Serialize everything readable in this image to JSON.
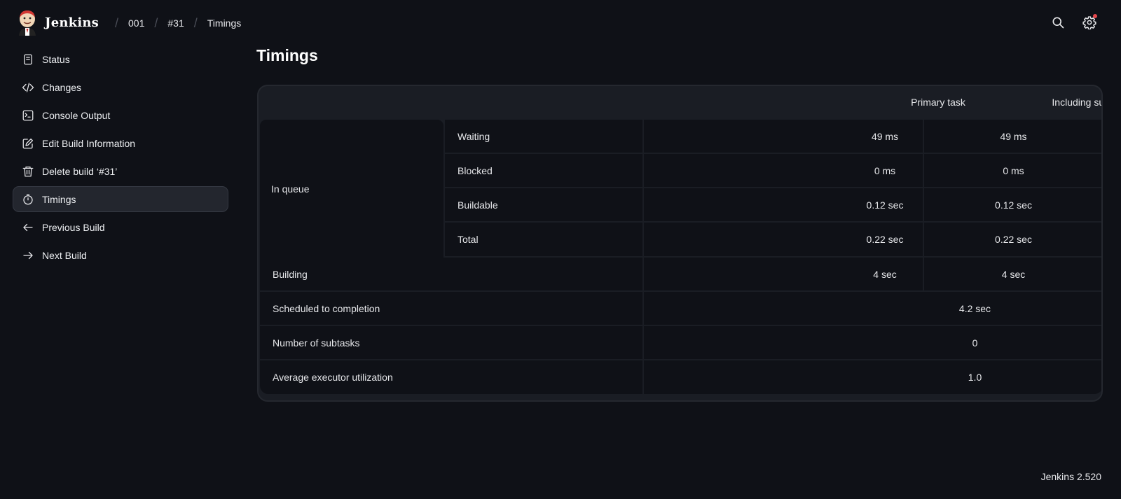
{
  "header": {
    "brand": "Jenkins",
    "breadcrumbs": [
      "001",
      "#31",
      "Timings"
    ]
  },
  "sidebar": {
    "items": [
      {
        "label": "Status",
        "icon": "status-icon"
      },
      {
        "label": "Changes",
        "icon": "code-icon"
      },
      {
        "label": "Console Output",
        "icon": "terminal-icon"
      },
      {
        "label": "Edit Build Information",
        "icon": "edit-icon"
      },
      {
        "label": "Delete build ‘#31’",
        "icon": "trash-icon"
      },
      {
        "label": "Timings",
        "icon": "timer-icon",
        "active": true
      },
      {
        "label": "Previous Build",
        "icon": "arrow-left-icon"
      },
      {
        "label": "Next Build",
        "icon": "arrow-right-icon"
      }
    ]
  },
  "main": {
    "title": "Timings",
    "columns": [
      "Primary task",
      "Including subtasks"
    ],
    "queue_group": "In queue",
    "queue_rows": [
      {
        "label": "Waiting",
        "primary": "49 ms",
        "including": "49 ms"
      },
      {
        "label": "Blocked",
        "primary": "0 ms",
        "including": "0 ms"
      },
      {
        "label": "Buildable",
        "primary": "0.12 sec",
        "including": "0.12 sec"
      },
      {
        "label": "Total",
        "primary": "0.22 sec",
        "including": "0.22 sec"
      }
    ],
    "building": {
      "label": "Building",
      "primary": "4 sec",
      "including": "4 sec"
    },
    "summary_rows": [
      {
        "label": "Scheduled to completion",
        "value": "4.2 sec"
      },
      {
        "label": "Number of subtasks",
        "value": "0"
      },
      {
        "label": "Average executor utilization",
        "value": "1.0"
      }
    ]
  },
  "footer": {
    "version": "Jenkins 2.520"
  },
  "colors": {
    "background": "#0f1117",
    "table_background": "#1a1d24",
    "active_item": "#23262e",
    "notification": "#e5484d"
  }
}
